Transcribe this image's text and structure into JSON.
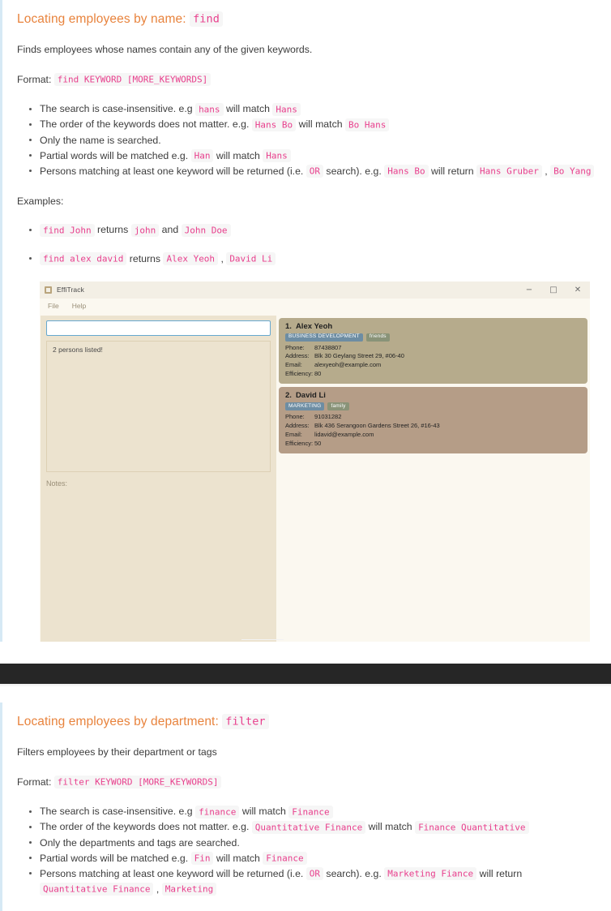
{
  "find_section": {
    "heading_text": "Locating employees by name:",
    "heading_code": "find",
    "description": "Finds employees whose names contain any of the given keywords.",
    "format_label": "Format:",
    "format_code": "find KEYWORD [MORE_KEYWORDS]",
    "bullets": [
      {
        "parts": [
          {
            "t": "text",
            "v": "The search is case-insensitive. e.g "
          },
          {
            "t": "code",
            "v": "hans"
          },
          {
            "t": "text",
            "v": " will match "
          },
          {
            "t": "code",
            "v": "Hans"
          }
        ]
      },
      {
        "parts": [
          {
            "t": "text",
            "v": "The order of the keywords does not matter. e.g. "
          },
          {
            "t": "code",
            "v": "Hans Bo"
          },
          {
            "t": "text",
            "v": " will match "
          },
          {
            "t": "code",
            "v": "Bo Hans"
          }
        ]
      },
      {
        "parts": [
          {
            "t": "text",
            "v": "Only the name is searched."
          }
        ]
      },
      {
        "parts": [
          {
            "t": "text",
            "v": "Partial words will be matched e.g. "
          },
          {
            "t": "code",
            "v": "Han"
          },
          {
            "t": "text",
            "v": " will match "
          },
          {
            "t": "code",
            "v": "Hans"
          }
        ]
      },
      {
        "parts": [
          {
            "t": "text",
            "v": "Persons matching at least one keyword will be returned (i.e. "
          },
          {
            "t": "code",
            "v": "OR"
          },
          {
            "t": "text",
            "v": " search). e.g. "
          },
          {
            "t": "code",
            "v": "Hans Bo"
          },
          {
            "t": "text",
            "v": " will return "
          },
          {
            "t": "code",
            "v": "Hans Gruber"
          },
          {
            "t": "text",
            "v": " , "
          },
          {
            "t": "code",
            "v": "Bo Yang"
          }
        ]
      }
    ],
    "examples_label": "Examples:",
    "examples": [
      {
        "parts": [
          {
            "t": "code",
            "v": "find John"
          },
          {
            "t": "text",
            "v": " returns "
          },
          {
            "t": "code",
            "v": "john"
          },
          {
            "t": "text",
            "v": " and "
          },
          {
            "t": "code",
            "v": "John Doe"
          }
        ]
      },
      {
        "parts": [
          {
            "t": "code",
            "v": "find alex david"
          },
          {
            "t": "text",
            "v": " returns "
          },
          {
            "t": "code",
            "v": "Alex Yeoh"
          },
          {
            "t": "text",
            "v": " , "
          },
          {
            "t": "code",
            "v": "David Li"
          }
        ]
      }
    ]
  },
  "app": {
    "title": "EffiTrack",
    "window_controls": {
      "minimize": "−",
      "maximize": "□",
      "close": "✕"
    },
    "menu": [
      "File",
      "Help"
    ],
    "command_input_value": "",
    "result_message": "2 persons listed!",
    "notes_label": "Notes:",
    "persons": [
      {
        "index": "1.",
        "name": "Alex Yeoh",
        "department": "BUSINESS DEVELOPMENT",
        "tag": "friends",
        "phone_label": "Phone:",
        "phone": "87438807",
        "address_label": "Address:",
        "address": "Blk 30 Geylang Street 29, #06-40",
        "email_label": "Email:",
        "email": "alexyeoh@example.com",
        "efficiency_label": "Efficiency:",
        "efficiency": "80"
      },
      {
        "index": "2.",
        "name": "David Li",
        "department": "MARKETING",
        "tag": "family",
        "phone_label": "Phone:",
        "phone": "91031282",
        "address_label": "Address:",
        "address": "Blk 436 Serangoon Gardens Street 26, #16-43",
        "email_label": "Email:",
        "email": "lidavid@example.com",
        "efficiency_label": "Efficiency:",
        "efficiency": "50"
      }
    ]
  },
  "filter_section": {
    "heading_text": "Locating employees by department:",
    "heading_code": "filter",
    "description": "Filters employees by their department or tags",
    "format_label": "Format:",
    "format_code": "filter KEYWORD [MORE_KEYWORDS]",
    "bullets": [
      {
        "parts": [
          {
            "t": "text",
            "v": "The search is case-insensitive. e.g "
          },
          {
            "t": "code",
            "v": "finance"
          },
          {
            "t": "text",
            "v": " will match "
          },
          {
            "t": "code",
            "v": "Finance"
          }
        ]
      },
      {
        "parts": [
          {
            "t": "text",
            "v": "The order of the keywords does not matter. e.g. "
          },
          {
            "t": "code",
            "v": "Quantitative Finance"
          },
          {
            "t": "text",
            "v": " will match "
          },
          {
            "t": "code",
            "v": "Finance Quantitative"
          }
        ]
      },
      {
        "parts": [
          {
            "t": "text",
            "v": "Only the departments and tags are searched."
          }
        ]
      },
      {
        "parts": [
          {
            "t": "text",
            "v": "Partial words will be matched e.g. "
          },
          {
            "t": "code",
            "v": "Fin"
          },
          {
            "t": "text",
            "v": " will match "
          },
          {
            "t": "code",
            "v": "Finance"
          }
        ]
      },
      {
        "parts": [
          {
            "t": "text",
            "v": "Persons matching at least one keyword will be returned (i.e. "
          },
          {
            "t": "code",
            "v": "OR"
          },
          {
            "t": "text",
            "v": " search). e.g. "
          },
          {
            "t": "code",
            "v": "Marketing Fiance"
          },
          {
            "t": "text",
            "v": " will return "
          },
          {
            "t": "code",
            "v": "Quantitative Finance"
          },
          {
            "t": "text",
            "v": " , "
          },
          {
            "t": "code",
            "v": "Marketing"
          }
        ]
      }
    ]
  },
  "colors": {
    "heading": "#e8833d",
    "code_text": "#e83e8c",
    "code_bg": "#f6f6f6",
    "left_border": "#d6e9f5",
    "band": "#262626",
    "app_bg": "#fbf8f0",
    "app_left_pane": "#ece3cf",
    "card_1": "#b6ab8c",
    "card_2": "#b59d87",
    "badge_dept": "#6d8da3",
    "badge_tag": "#899378",
    "input_border": "#66a8d0"
  }
}
